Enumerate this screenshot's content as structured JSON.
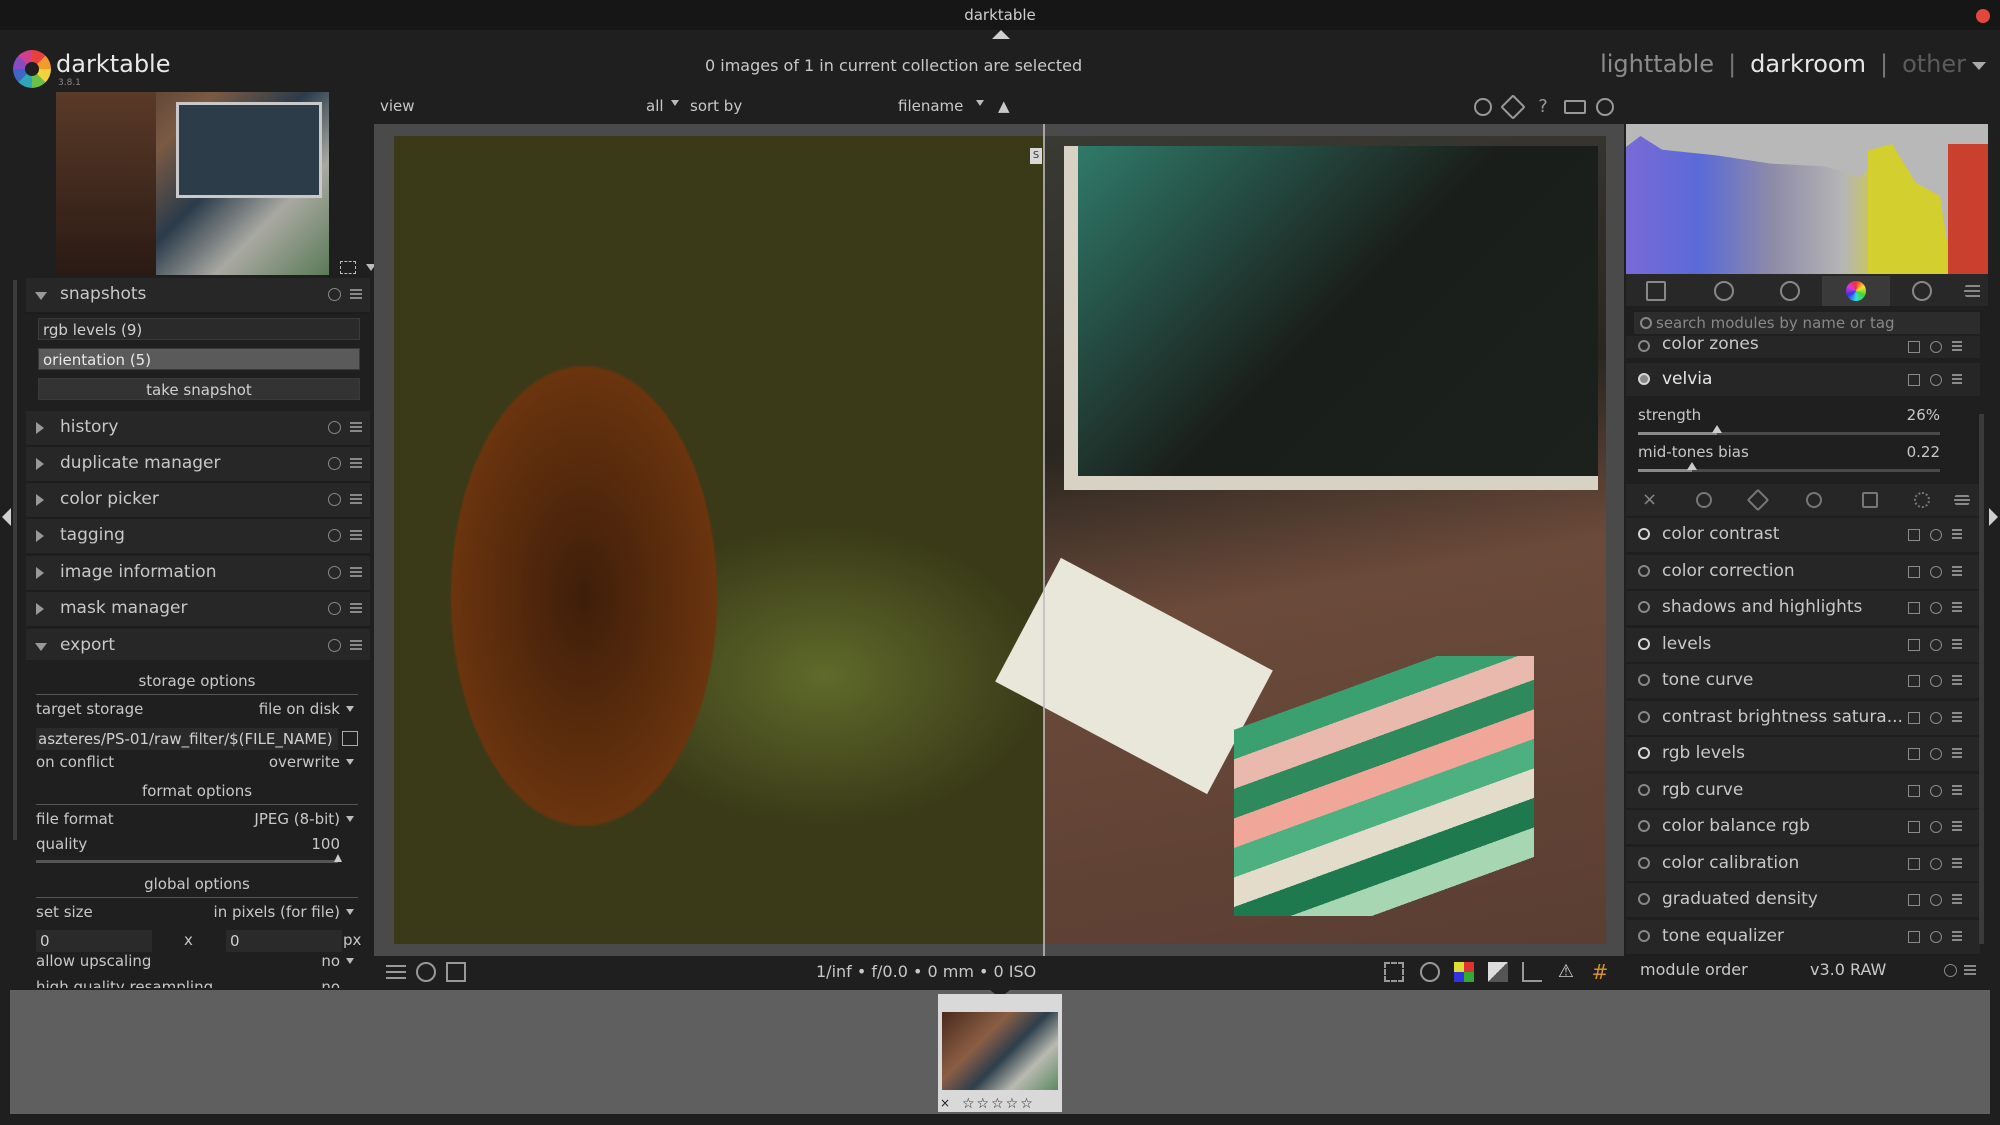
{
  "window": {
    "title": "darktable"
  },
  "header": {
    "app_name": "darktable",
    "version": "3.8.1",
    "collection_status": "0 images of 1 in current collection are selected",
    "views": [
      "lighttable",
      "darkroom",
      "other"
    ],
    "active_view": "darkroom",
    "separator": "|"
  },
  "left": {
    "snapshots": {
      "title": "snapshots",
      "items": [
        "rgb levels (9)",
        "orientation (5)"
      ],
      "take_label": "take snapshot"
    },
    "modules": [
      "history",
      "duplicate manager",
      "color picker",
      "tagging",
      "image information",
      "mask manager",
      "export"
    ],
    "export": {
      "storage_title": "storage options",
      "target_storage_label": "target storage",
      "target_storage_value": "file on disk",
      "path": "aszteres/PS-01/raw_filter/$(FILE_NAME)",
      "on_conflict_label": "on conflict",
      "on_conflict_value": "overwrite",
      "format_title": "format options",
      "file_format_label": "file format",
      "file_format_value": "JPEG (8-bit)",
      "quality_label": "quality",
      "quality_value": "100",
      "global_title": "global options",
      "set_size_label": "set size",
      "set_size_value": "in pixels (for file)",
      "width": "0",
      "height": "0",
      "x_label": "x",
      "px_label": "px",
      "upscaling_label": "allow upscaling",
      "upscaling_value": "no",
      "hq_label": "high quality resampling",
      "hq_value": "no"
    }
  },
  "center": {
    "toolbar": {
      "view_label": "view",
      "filter_value": "all",
      "sort_label": "sort by",
      "sort_value": "filename",
      "sort_dir": "▲"
    },
    "split_marker": "S",
    "exif": "1/inf • f/0.0 • 0 mm • 0 ISO"
  },
  "right": {
    "search_placeholder": "search modules by name or tag",
    "modules_top": [
      {
        "label": "color zones",
        "on": false
      },
      {
        "label": "velvia",
        "on": true
      }
    ],
    "velvia_params": [
      {
        "label": "strength",
        "value": "26%",
        "level": 0.26
      },
      {
        "label": "mid-tones bias",
        "value": "0.22",
        "level": 0.18
      }
    ],
    "modules": [
      {
        "label": "color contrast",
        "on": true
      },
      {
        "label": "color correction",
        "on": false
      },
      {
        "label": "shadows and highlights",
        "on": false
      },
      {
        "label": "levels",
        "on": true
      },
      {
        "label": "tone curve",
        "on": false
      },
      {
        "label": "contrast brightness satura...",
        "on": false
      },
      {
        "label": "rgb levels",
        "on": true
      },
      {
        "label": "rgb curve",
        "on": false
      },
      {
        "label": "color balance rgb",
        "on": false
      },
      {
        "label": "color calibration",
        "on": false
      },
      {
        "label": "graduated density",
        "on": false
      },
      {
        "label": "tone equalizer",
        "on": false
      }
    ],
    "module_order_label": "module order",
    "module_order_value": "v3.0 RAW"
  },
  "filmstrip": {
    "stars": "☆☆☆☆☆",
    "reject": "×"
  },
  "colors": {
    "background": "#1f1f1f",
    "panel": "#262626",
    "filmstrip": "#5f5f5f",
    "close_button": "#e2473f"
  }
}
